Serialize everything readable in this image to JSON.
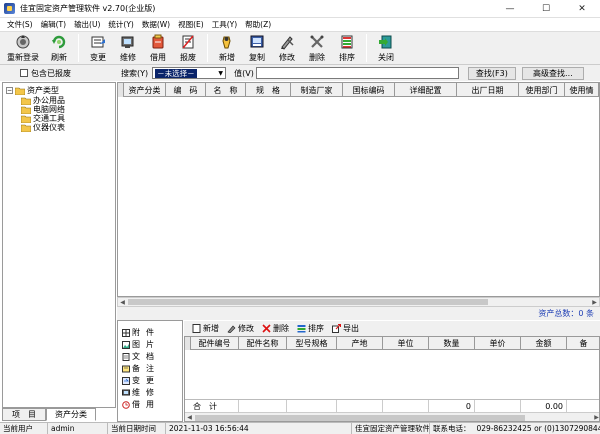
{
  "window": {
    "title": "佳宜固定资产管理软件 v2.70(企业版)",
    "minimize": "—",
    "maximize": "☐",
    "close": "✕"
  },
  "menu": [
    "文件(S)",
    "编辑(T)",
    "输出(U)",
    "统计(Y)",
    "数据(W)",
    "视图(E)",
    "工具(Y)",
    "帮助(Z)"
  ],
  "toolbar": {
    "relogin": "重新登录",
    "refresh": "刷新",
    "change": "变更",
    "repair": "维修",
    "borrow": "借用",
    "scrap": "报废",
    "add": "新增",
    "copy": "复制",
    "modify": "修改",
    "delete": "删除",
    "sort": "排序",
    "close": "关闭"
  },
  "search": {
    "include_scrapped": "包含已报废",
    "search_label": "搜索(Y)",
    "combo_value": "－未选择－",
    "value_label": "值(V)",
    "find_button": "查找(F3)",
    "advanced_button": "高级查找..."
  },
  "tree": {
    "root": "资产类型",
    "children": [
      "办公用品",
      "电脑网络",
      "交通工具",
      "仪器仪表"
    ]
  },
  "tabs": [
    "项　目",
    "资产分类"
  ],
  "asset_table": {
    "columns": [
      "资产分类",
      "编　码",
      "名　称",
      "规　格",
      "制造厂家",
      "国标编码",
      "详细配置",
      "出厂日期",
      "使用部门",
      "使用情"
    ]
  },
  "asset_total": "资产总数：0 条",
  "attach_panel": [
    {
      "a": "附",
      "b": "件"
    },
    {
      "a": "图",
      "b": "片"
    },
    {
      "a": "文",
      "b": "档"
    },
    {
      "a": "备",
      "b": "注"
    },
    {
      "a": "变",
      "b": "更"
    },
    {
      "a": "维",
      "b": "修"
    },
    {
      "a": "借",
      "b": "用"
    }
  ],
  "parts_toolbar": {
    "add": "新增",
    "modify": "修改",
    "delete": "删除",
    "sort": "排序",
    "export": "导出"
  },
  "parts_table": {
    "columns": [
      "配件编号",
      "配件名称",
      "型号规格",
      "产地",
      "单位",
      "数量",
      "单价",
      "金额",
      "备"
    ],
    "total_label": "合　计",
    "total_qty": "0",
    "total_amount": "0.00"
  },
  "status": {
    "user_label": "当前用户",
    "user": "admin",
    "date_label": "当前日期时间",
    "datetime": "2021-11-03 16:56:44",
    "product": "佳宜固定资产管理软件",
    "contact_label": "联系电话：",
    "contact": "029-86232425 or (0)1307290844"
  }
}
